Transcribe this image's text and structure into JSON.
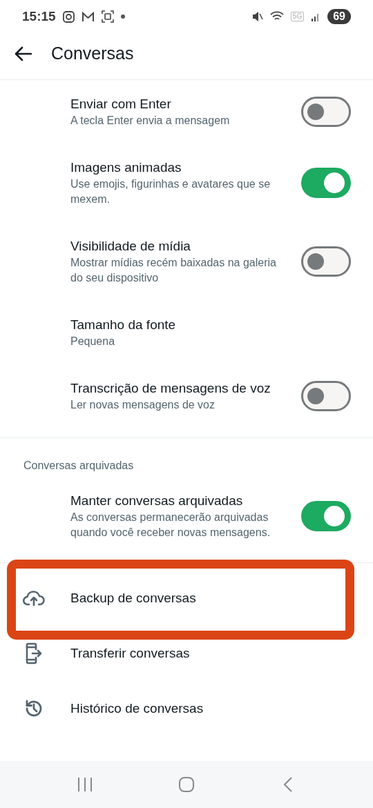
{
  "status_bar": {
    "time": "15:15",
    "network": "5G",
    "battery": "69"
  },
  "header": {
    "title": "Conversas"
  },
  "settings": [
    {
      "kind": "toggle",
      "title": "Enviar com Enter",
      "subtitle": "A tecla Enter envia a mensagem",
      "on": false
    },
    {
      "kind": "toggle",
      "title": "Imagens animadas",
      "subtitle": "Use emojis, figurinhas e avatares que se mexem.",
      "on": true
    },
    {
      "kind": "toggle",
      "title": "Visibilidade de mídia",
      "subtitle": "Mostrar mídias recém baixadas na galeria do seu dispositivo",
      "on": false
    },
    {
      "kind": "value",
      "title": "Tamanho da fonte",
      "subtitle": "Pequena"
    },
    {
      "kind": "toggle",
      "title": "Transcrição de mensagens de voz",
      "subtitle": "Ler novas mensagens de voz",
      "on": false
    }
  ],
  "archived": {
    "heading": "Conversas arquivadas",
    "items": [
      {
        "kind": "toggle",
        "title": "Manter conversas arquivadas",
        "subtitle": "As conversas permanecerão arquivadas quando você receber novas mensagens.",
        "on": true
      }
    ]
  },
  "actions": [
    {
      "kind": "cloud",
      "label": "Backup de conversas",
      "highlighted": true
    },
    {
      "kind": "transfer",
      "label": "Transferir conversas",
      "highlighted": false
    },
    {
      "kind": "history",
      "label": "Histórico de conversas",
      "highlighted": false
    }
  ]
}
